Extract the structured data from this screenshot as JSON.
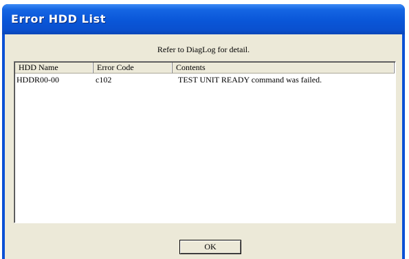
{
  "window": {
    "title": "Error HDD List"
  },
  "dialog": {
    "message": "Refer to DiagLog for detail."
  },
  "list": {
    "columns": [
      "HDD Name",
      "Error Code",
      "Contents"
    ],
    "rows": [
      [
        "HDDR00-00",
        "c102",
        "TEST UNIT READY command was failed."
      ]
    ]
  },
  "buttons": {
    "ok_label": "OK"
  },
  "colors": {
    "titlebar": "#0a56d8",
    "face": "#ece9d8",
    "list_background": "#ffffff"
  }
}
